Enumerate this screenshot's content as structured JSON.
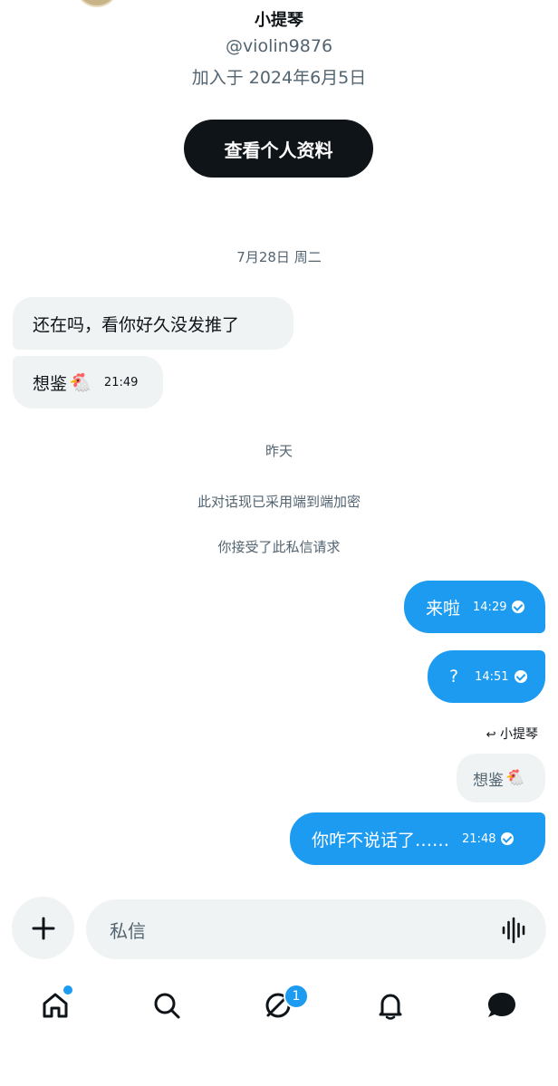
{
  "profile": {
    "name": "小提琴",
    "handle": "@violin9876",
    "joined": "加入于 2024年6月5日",
    "view_profile_label": "查看个人资料"
  },
  "messages": {
    "date_header": "7月28日 周二",
    "incoming_1": "还在吗，看你好久没发推了",
    "incoming_2": "想鉴",
    "incoming_2_time": "21:49",
    "yesterday": "昨天",
    "encryption_notice": "此对话现已采用端到端加密",
    "request_notice": "你接受了此私信请求",
    "outgoing_1": "来啦",
    "outgoing_1_time": "14:29",
    "outgoing_2": "?",
    "outgoing_2_time": "14:51",
    "reply_to_label": "小提琴",
    "quoted_text": "想鉴",
    "outgoing_3": "你咋不说话了……",
    "outgoing_3_time": "21:48"
  },
  "composer": {
    "placeholder": "私信"
  },
  "bottom_nav": {
    "messages_badge": "1"
  },
  "colors": {
    "accent": "#1d9bf0",
    "bubble_in": "#eff3f4",
    "text_primary": "#0f1419",
    "text_secondary": "#536471"
  },
  "icons": [
    "plus-icon",
    "voice-waveform-icon",
    "home-icon",
    "search-icon",
    "grok-icon",
    "bell-icon",
    "chat-icon",
    "reply-arrow-icon",
    "rooster-emoji",
    "read-check-icon"
  ]
}
